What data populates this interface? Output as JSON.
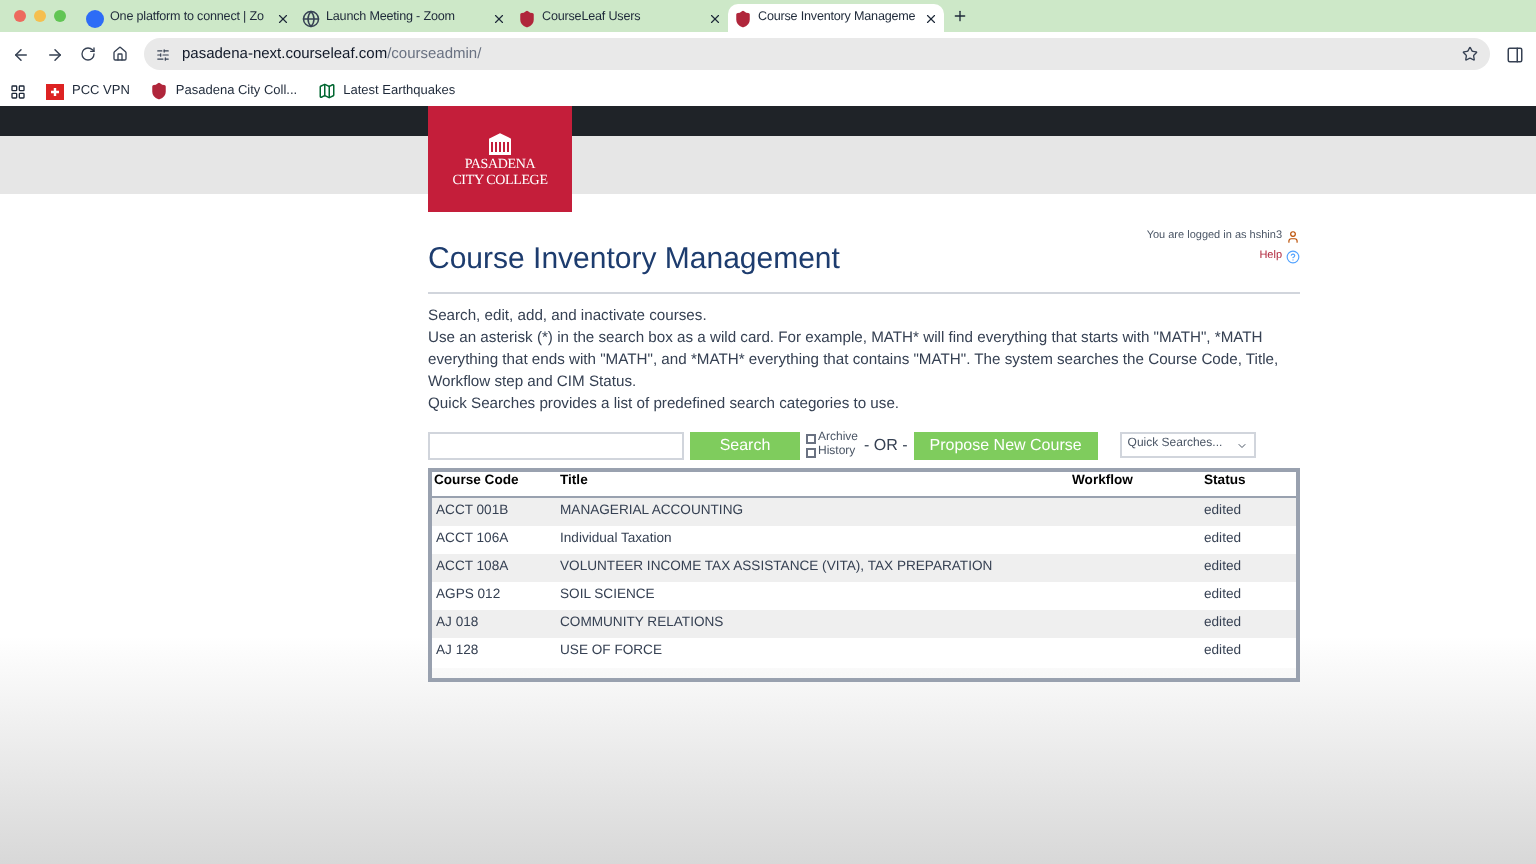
{
  "browser": {
    "tabs": [
      {
        "label": "One platform to connect | Zo",
        "selected": false,
        "kind": "zoom"
      },
      {
        "label": "Launch Meeting - Zoom",
        "selected": false,
        "kind": "globe"
      },
      {
        "label": "CourseLeaf Users",
        "selected": false,
        "kind": "shield"
      },
      {
        "label": "Course Inventory Manageme",
        "selected": true,
        "kind": "shield"
      }
    ],
    "address": {
      "domain": "pasadena-next.courseleaf.com",
      "path": "/courseadmin/"
    },
    "bookmarks": [
      {
        "label": "PCC VPN",
        "kind": "vpn"
      },
      {
        "label": "Pasadena City Coll...",
        "kind": "shield"
      },
      {
        "label": "Latest Earthquakes",
        "kind": "map"
      }
    ]
  },
  "logo": {
    "line_1": "PASADENA",
    "line_2": "CITY COLLEGE"
  },
  "user": {
    "logged_in": "You are logged in as hshin3",
    "help": "Help"
  },
  "title": "Course Inventory Management",
  "intro": [
    "Search, edit, add, and inactivate courses.",
    "Use an asterisk (*) in the search box as a wild card. For example, MATH* will find everything that starts with \"MATH\", *MATH everything that ends with \"MATH\", and *MATH* everything that contains \"MATH\". The system searches the Course Code, Title, Workflow step and CIM Status.",
    "Quick Searches provides a list of predefined search categories to use."
  ],
  "search": {
    "button": "Search",
    "archive": {
      "label": "Archive",
      "checked": false
    },
    "history": {
      "label": "History",
      "checked": false
    },
    "or": "- OR -",
    "propose": "Propose New Course",
    "quick": "Quick Searches..."
  },
  "table": {
    "columns": [
      "Course Code",
      "Title",
      "Workflow",
      "Status"
    ],
    "rows": [
      {
        "code": "ACCT 001B",
        "title": "MANAGERIAL ACCOUNTING",
        "workflow": "",
        "status": "edited"
      },
      {
        "code": "ACCT 106A",
        "title": "Individual Taxation",
        "workflow": "",
        "status": "edited"
      },
      {
        "code": "ACCT 108A",
        "title": "VOLUNTEER INCOME TAX ASSISTANCE (VITA), TAX PREPARATION",
        "workflow": "",
        "status": "edited"
      },
      {
        "code": "AGPS 012",
        "title": "SOIL SCIENCE",
        "workflow": "",
        "status": "edited"
      },
      {
        "code": "AJ 018",
        "title": "COMMUNITY RELATIONS",
        "workflow": "",
        "status": "edited"
      },
      {
        "code": "AJ 128",
        "title": "USE OF FORCE",
        "workflow": "",
        "status": "edited"
      }
    ]
  }
}
